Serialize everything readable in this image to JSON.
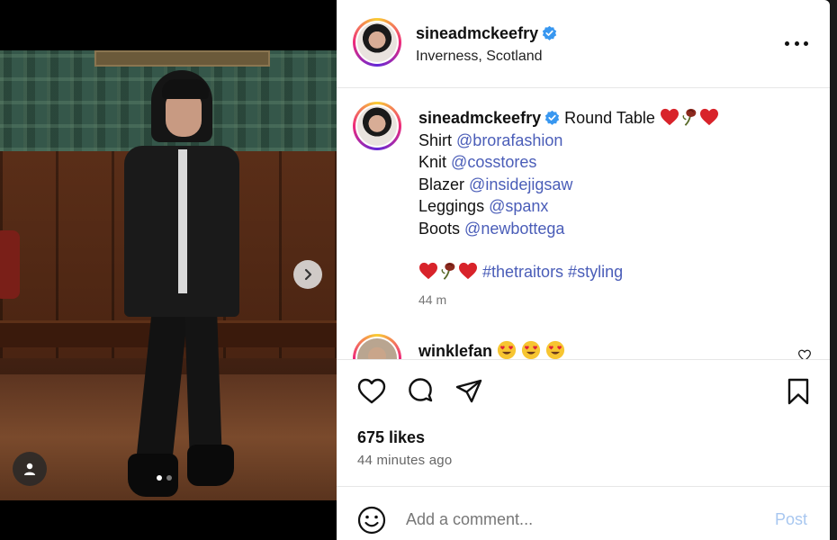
{
  "post": {
    "username": "sineadmckeefry",
    "location": "Inverness, Scotland",
    "verified": true
  },
  "caption": {
    "username": "sineadmckeefry",
    "title": "Round Table",
    "title_emojis": [
      "red-heart",
      "wilted-rose",
      "red-heart"
    ],
    "lines": [
      {
        "label": "Shirt",
        "mention": "@brorafashion"
      },
      {
        "label": "Knit",
        "mention": "@cosstores"
      },
      {
        "label": "Blazer",
        "mention": "@insidejigsaw"
      },
      {
        "label": "Leggings",
        "mention": "@spanx"
      },
      {
        "label": "Boots",
        "mention": "@newbottega"
      }
    ],
    "hashtags": "#thetraitors #styling",
    "time": "44 m"
  },
  "comment": {
    "username": "winklefan",
    "emojis": [
      "heart-eyes",
      "heart-eyes",
      "heart-eyes"
    ]
  },
  "actions": {
    "likes": "675 likes",
    "time_ago": "44 minutes ago"
  },
  "add_comment": {
    "placeholder": "Add a comment...",
    "post_label": "Post"
  },
  "carousel": {
    "total": 2,
    "active": 1
  },
  "colors": {
    "mention": "#4a5db8",
    "verified": "#3897f0",
    "post_disabled": "#a8c7f0",
    "heart": "#d8232a"
  }
}
